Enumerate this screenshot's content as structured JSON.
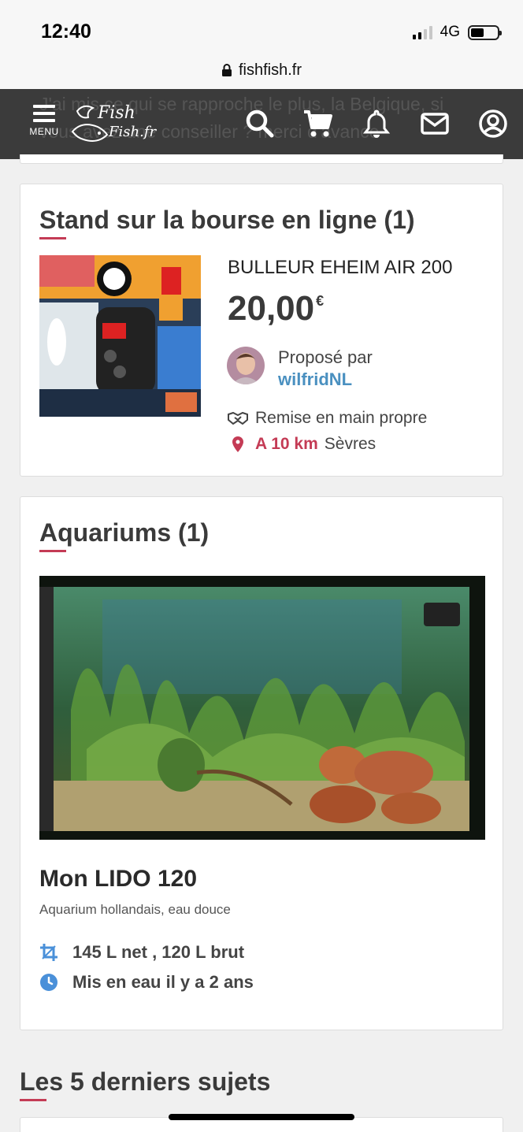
{
  "status_bar": {
    "time": "12:40",
    "network": "4G",
    "battery_level": 0.5
  },
  "browser": {
    "url": "fishfish.fr"
  },
  "nav": {
    "menu_label": "MENU",
    "logo_line1": "Fish",
    "logo_line2": "Fish.fr",
    "background_text_line1": "J'ai mis ce qui se rapproche le plus, la Belgique, si",
    "background_text_line2": "vous avez une conseiller ? merci d'avance",
    "icons": [
      "search-icon",
      "cart-icon",
      "bell-icon",
      "mail-icon",
      "user-icon"
    ]
  },
  "stand": {
    "title": "Stand sur la bourse en ligne (1)",
    "product_name": "BULLEUR EHEIM AIR 200",
    "price": "20,00",
    "currency": "€",
    "proposed_by_label": "Proposé par",
    "seller": "wilfridNL",
    "handover": "Remise en main propre",
    "distance": "A 10 km",
    "city": "Sèvres"
  },
  "aquariums": {
    "title": "Aquariums (1)",
    "name": "Mon LIDO 120",
    "description": "Aquarium hollandais, eau douce",
    "volume": "145 L net , 120 L brut",
    "age": "Mis en eau il y a 2 ans"
  },
  "latest": {
    "title": "Les 5 derniers sujets"
  },
  "colors": {
    "accent": "#c43b55",
    "link": "#4a90c0",
    "nav_bg": "#3b3b3b",
    "spec_icon": "#4a90d9"
  }
}
